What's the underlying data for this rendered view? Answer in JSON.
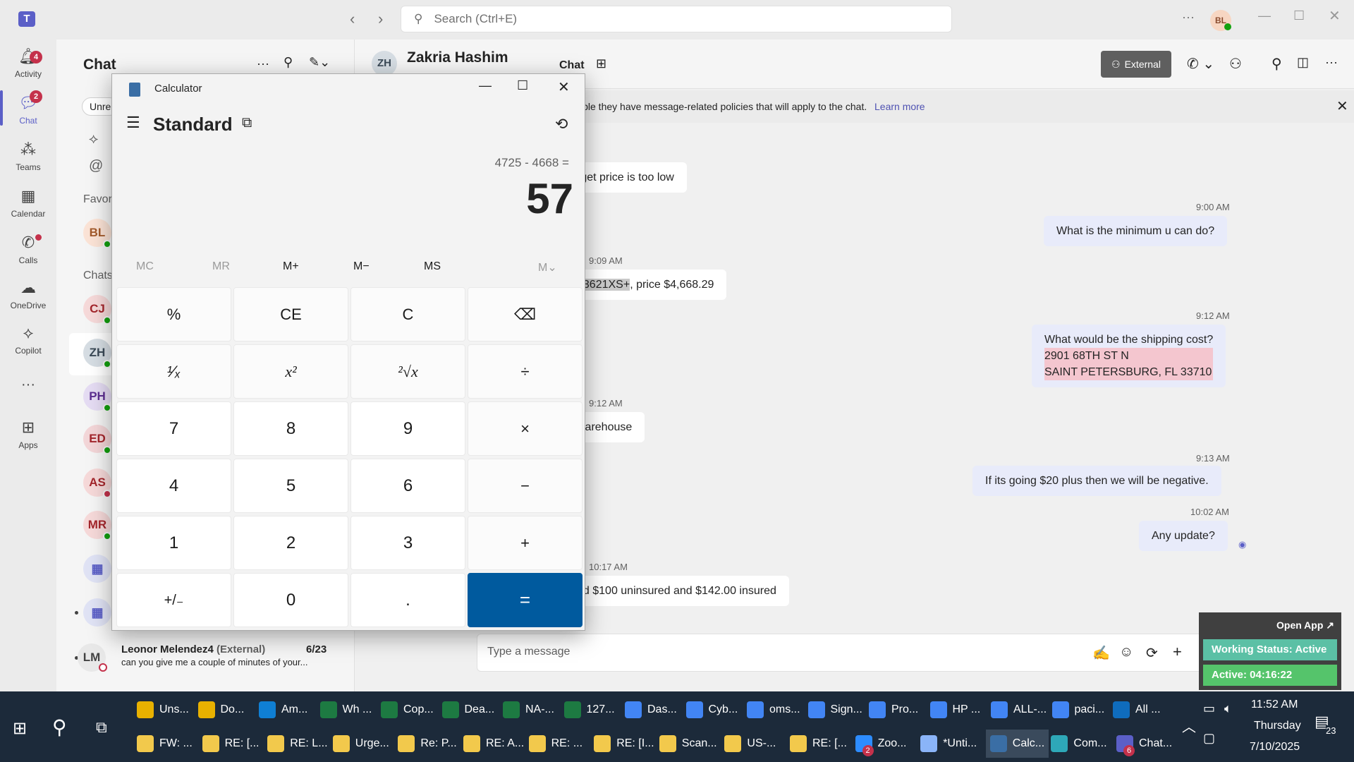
{
  "titlebar": {
    "search_placeholder": "Search (Ctrl+E)",
    "user_initials": "BL"
  },
  "rail": {
    "activity": {
      "label": "Activity",
      "badge": "4"
    },
    "chat": {
      "label": "Chat",
      "badge": "2"
    },
    "teams": {
      "label": "Teams"
    },
    "calendar": {
      "label": "Calendar"
    },
    "calls": {
      "label": "Calls"
    },
    "onedrive": {
      "label": "OneDrive"
    },
    "copilot": {
      "label": "Copilot"
    },
    "apps": {
      "label": "Apps"
    }
  },
  "chatlist": {
    "title": "Chat",
    "filter_unread": "Unre",
    "favorites_label": "Favori",
    "chats_label": "Chats",
    "avatars": [
      "BL",
      "CJ",
      "ZH",
      "PH",
      "ED",
      "AS",
      "MR"
    ],
    "last_item": {
      "initials": "LM",
      "name": "Leonor Melendez4",
      "tag": "(External)",
      "date": "6/23",
      "preview": "can you give me a couple of minutes of your..."
    }
  },
  "chatheader": {
    "initials": "ZH",
    "name": "Zakria Hashim",
    "tab": "Chat",
    "external_label": "External"
  },
  "banner": {
    "text": "ible they have message-related policies that will apply to the chat.",
    "link": "Learn more"
  },
  "messages": [
    {
      "dir": "in",
      "text": "rget price is too low"
    },
    {
      "dir": "out",
      "time": "9:00 AM",
      "text": "What is the minimum u can do?"
    },
    {
      "dir": "in",
      "time": "9:09 AM",
      "highlight": "53621XS+",
      "text": ", price $4,668.29"
    },
    {
      "dir": "out",
      "time": "9:12 AM",
      "lines": [
        "What would be the shipping cost?",
        "2901 68TH ST N",
        "SAINT PETERSBURG, FL 33710"
      ]
    },
    {
      "dir": "in",
      "time": "9:12 AM",
      "text": "warehouse"
    },
    {
      "dir": "out",
      "time": "9:13 AM",
      "text": "If its going $20 plus then we will be negative."
    },
    {
      "dir": "out",
      "time": "10:02 AM",
      "text": "Any update?"
    },
    {
      "dir": "in",
      "time": "10:17 AM",
      "text": "nd $100 uninsured and $142.00 insured"
    }
  ],
  "composer": {
    "placeholder": "Type a message"
  },
  "calculator": {
    "title": "Calculator",
    "mode": "Standard",
    "expression": "4725 - 4668 =",
    "display": "57",
    "memory": [
      "MC",
      "MR",
      "M+",
      "M−",
      "MS",
      "M⌄"
    ],
    "keys": [
      [
        "%",
        "CE",
        "C",
        "⌫"
      ],
      [
        "¹⁄ₓ",
        "x²",
        "²√x",
        "÷"
      ],
      [
        "7",
        "8",
        "9",
        "×"
      ],
      [
        "4",
        "5",
        "6",
        "−"
      ],
      [
        "1",
        "2",
        "3",
        "+"
      ],
      [
        "+/₋",
        "0",
        ".",
        "="
      ]
    ]
  },
  "working_status": {
    "open_app": "Open App ↗",
    "status": "Working Status: Active",
    "active": "Active: 04:16:22"
  },
  "taskbar": {
    "row1": [
      "Uns...",
      "Do...",
      "Am...",
      "Wh ...",
      "Cop...",
      "Dea...",
      "NA-...",
      "127...",
      "Das...",
      "Cyb...",
      "oms...",
      "Sign...",
      "Pro...",
      "HP ...",
      "ALL-...",
      "paci...",
      "All ..."
    ],
    "row2": [
      "FW: ...",
      "RE: [...",
      "RE: L...",
      "Urge...",
      "Re: P...",
      "RE: A...",
      "RE: ...",
      "RE: [I...",
      "Scan...",
      "US-...",
      "RE: [...",
      "Zoo...",
      "*Unti...",
      "Calc...",
      "Com...",
      "Chat..."
    ],
    "zoom_badge": "2",
    "chat_badge": "6",
    "time": "11:52 AM",
    "day": "Thursday",
    "date": "7/10/2025",
    "notif": "23"
  }
}
